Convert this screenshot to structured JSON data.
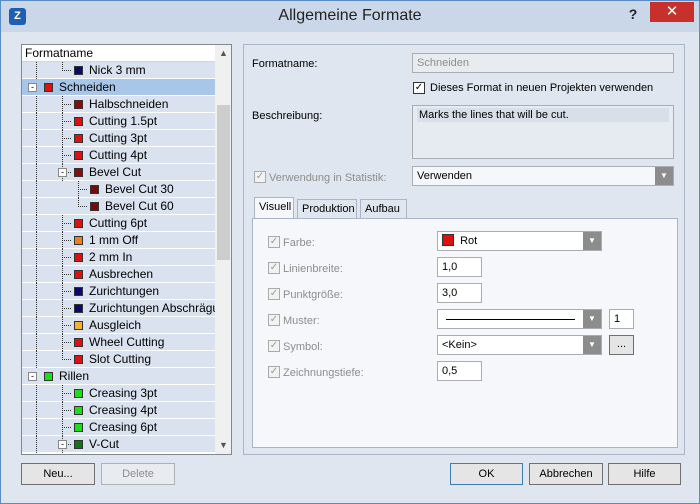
{
  "window": {
    "title": "Allgemeine Formate",
    "help": "?",
    "close": "✕",
    "icon": "app-logo-icon",
    "icon_glyph": "Z"
  },
  "tree": {
    "header": "Formatname",
    "rows": [
      {
        "label": "Nick 3 mm",
        "color": "#0a0a6e",
        "level": 1,
        "last": true
      },
      {
        "label": "Schneiden",
        "color": "#e01010",
        "level": 0,
        "expander": "-",
        "selected": true
      },
      {
        "label": "Halbschneiden",
        "color": "#8b0a0a",
        "level": 1
      },
      {
        "label": "Cutting 1.5pt",
        "color": "#e01010",
        "level": 1
      },
      {
        "label": "Cutting 3pt",
        "color": "#e01010",
        "level": 1
      },
      {
        "label": "Cutting 4pt",
        "color": "#e01010",
        "level": 1
      },
      {
        "label": "Bevel Cut",
        "color": "#8b0a0a",
        "level": 1,
        "expander": "-"
      },
      {
        "label": "Bevel Cut 30",
        "color": "#7a0a0a",
        "level": 2
      },
      {
        "label": "Bevel Cut 60",
        "color": "#7a0a0a",
        "level": 2,
        "last": true
      },
      {
        "label": "Cutting 6pt",
        "color": "#e01010",
        "level": 1
      },
      {
        "label": "1 mm Off",
        "color": "#f08018",
        "level": 1
      },
      {
        "label": "2 mm In",
        "color": "#e01010",
        "level": 1
      },
      {
        "label": "Ausbrechen",
        "color": "#e01010",
        "level": 1
      },
      {
        "label": "Zurichtungen",
        "color": "#0a0a6e",
        "level": 1
      },
      {
        "label": "Zurichtungen Abschrägung",
        "color": "#0a0a6e",
        "level": 1
      },
      {
        "label": "Ausgleich",
        "color": "#f5b030",
        "level": 1
      },
      {
        "label": "Wheel Cutting",
        "color": "#e01010",
        "level": 1
      },
      {
        "label": "Slot Cutting",
        "color": "#e01010",
        "level": 1,
        "last": true
      },
      {
        "label": "Rillen",
        "color": "#18e018",
        "level": 0,
        "expander": "-"
      },
      {
        "label": "Creasing 3pt",
        "color": "#18e018",
        "level": 1
      },
      {
        "label": "Creasing 4pt",
        "color": "#18e018",
        "level": 1
      },
      {
        "label": "Creasing 6pt",
        "color": "#18e018",
        "level": 1
      },
      {
        "label": "V-Cut",
        "color": "#0a7a0a",
        "level": 1,
        "expander": "-"
      }
    ],
    "scroll_up": "▲",
    "scroll_down": "▼"
  },
  "form": {
    "formatname_label": "Formatname:",
    "formatname_value": "Schneiden",
    "use_in_new_label": "Dieses Format in neuen Projekten verwenden",
    "use_in_new_checked": true,
    "beschreibung_label": "Beschreibung:",
    "beschreibung_value": "Marks the lines that will be cut.",
    "statistik_label": "Verwendung in Statistik:",
    "statistik_value": "Verwenden",
    "tabs": [
      "Visuell",
      "Produktion",
      "Aufbau"
    ],
    "active_tab": 0,
    "visuell": {
      "farbe_label": "Farbe:",
      "farbe_value": "Rot",
      "farbe_color": "#e01010",
      "linienbreite_label": "Linienbreite:",
      "linienbreite_value": "1,0",
      "punktgroesse_label": "Punktgröße:",
      "punktgroesse_value": "3,0",
      "muster_label": "Muster:",
      "muster_value": "1",
      "symbol_label": "Symbol:",
      "symbol_value": "<Kein>",
      "symbol_browse": "...",
      "zeichnungstiefe_label": "Zeichnungstiefe:",
      "zeichnungstiefe_value": "0,5"
    }
  },
  "buttons": {
    "neu": "Neu...",
    "delete": "Delete",
    "ok": "OK",
    "abbrechen": "Abbrechen",
    "hilfe": "Hilfe"
  },
  "dropdown_glyph": "▼",
  "check_glyph": "✓"
}
